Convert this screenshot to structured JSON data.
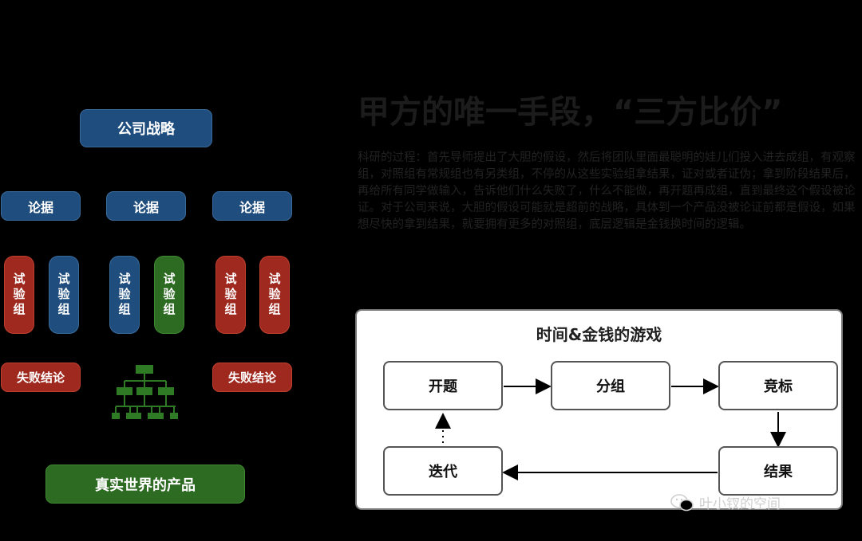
{
  "left_diagram": {
    "strategy": "公司战略",
    "arguments": [
      "论据",
      "论据",
      "论据"
    ],
    "experiments": [
      "试验组",
      "试验组",
      "试验组",
      "试验组",
      "试验组",
      "试验组"
    ],
    "failures": [
      "失败结论",
      "失败结论"
    ],
    "product": "真实世界的产品",
    "colors": {
      "blue": "#1f4e7e",
      "red": "#a0291f",
      "green": "#2d6a22"
    }
  },
  "article": {
    "title": "甲方的唯一手段，“三方比价”",
    "paragraph": "科研的过程：首先导师提出了大胆的假设，然后将团队里面最聪明的娃儿们投入进去成组，有观察组，对照组有常规组也有另类组，不停的从这些实验组拿结果，证对或者证伪；拿到阶段结果后，再给所有同学做输入，告诉他们什么失败了，什么不能做，再开题再成组，直到最终这个假设被论证。对于公司来说，大胆的假设可能就是超前的战略，具体到一个产品没被论证前都是假设，如果想尽快的拿到结果，就要拥有更多的对照组，底层逻辑是金钱换时间的逻辑。"
  },
  "game_box": {
    "title": "时间&金钱的游戏",
    "nodes": {
      "start": "开题",
      "group": "分组",
      "bid": "竞标",
      "result": "结果",
      "iterate": "迭代"
    }
  },
  "watermark": {
    "text": "叶小钗的空间"
  }
}
